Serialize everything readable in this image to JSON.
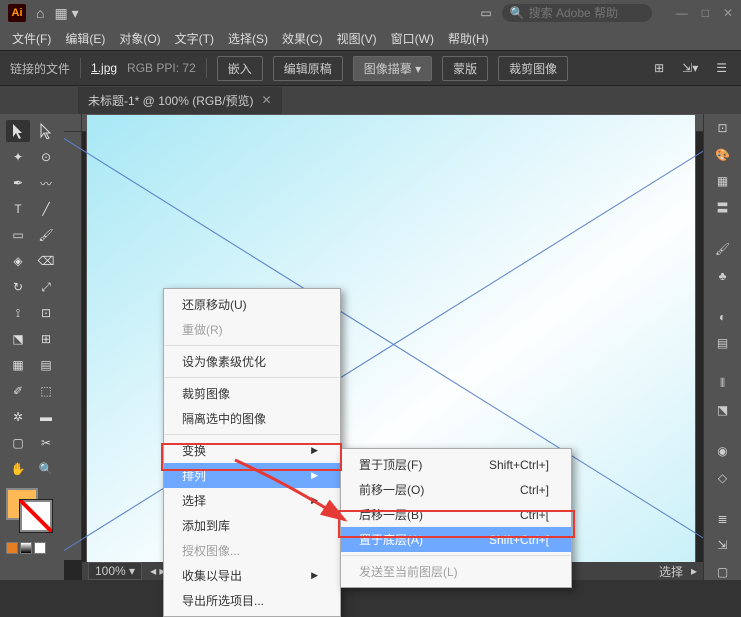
{
  "title": {
    "home": "⌂"
  },
  "search": {
    "placeholder": "搜索 Adobe 帮助"
  },
  "menu": {
    "file": "文件(F)",
    "edit": "编辑(E)",
    "object": "对象(O)",
    "type": "文字(T)",
    "select": "选择(S)",
    "effect": "效果(C)",
    "view": "视图(V)",
    "window": "窗口(W)",
    "help": "帮助(H)"
  },
  "opts": {
    "label": "链接的文件",
    "file": "1.jpg",
    "mode": "RGB PPI: 72",
    "embed": "嵌入",
    "editorig": "编辑原稿",
    "trace": "图像描摹",
    "mask": "蒙版",
    "crop": "裁剪图像"
  },
  "tab": {
    "name": "未标题-1* @ 100% (RGB/预览)"
  },
  "zoom": {
    "value": "100%"
  },
  "scroll": {
    "sel": "选择"
  },
  "ctx1": {
    "undo": "还原移动(U)",
    "redo": "重做(R)",
    "pixel": "设为像素级优化",
    "crop": "裁剪图像",
    "isolate": "隔离选中的图像",
    "transform": "变换",
    "arrange": "排列",
    "select": "选择",
    "addlib": "添加到库",
    "license": "授权图像...",
    "export": "收集以导出",
    "exportsel": "导出所选项目..."
  },
  "ctx2": {
    "front": "置于顶层(F)",
    "frontk": "Shift+Ctrl+]",
    "forward": "前移一层(O)",
    "forwardk": "Ctrl+]",
    "backward": "后移一层(B)",
    "backwardk": "Ctrl+[",
    "back": "置于底层(A)",
    "backk": "Shift+Ctrl+[",
    "sendlayer": "发送至当前图层(L)"
  }
}
